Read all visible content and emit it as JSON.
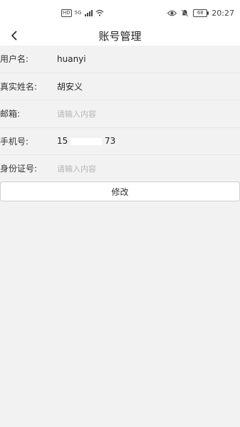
{
  "status_bar": {
    "hd": "HD",
    "network": "5G",
    "battery": "68",
    "time": "20:27"
  },
  "header": {
    "title": "账号管理"
  },
  "form": {
    "rows": [
      {
        "label": "用户名:",
        "value": "huanyi",
        "placeholder": ""
      },
      {
        "label": "真实姓名:",
        "value": "胡安义",
        "placeholder": ""
      },
      {
        "label": "邮箱:",
        "value": "",
        "placeholder": "请输入内容"
      },
      {
        "label": "手机号:",
        "value_prefix": "15",
        "value_suffix": "73",
        "placeholder": ""
      },
      {
        "label": "身份证号:",
        "value": "",
        "placeholder": "请输入内容"
      }
    ],
    "submit_label": "修改"
  }
}
